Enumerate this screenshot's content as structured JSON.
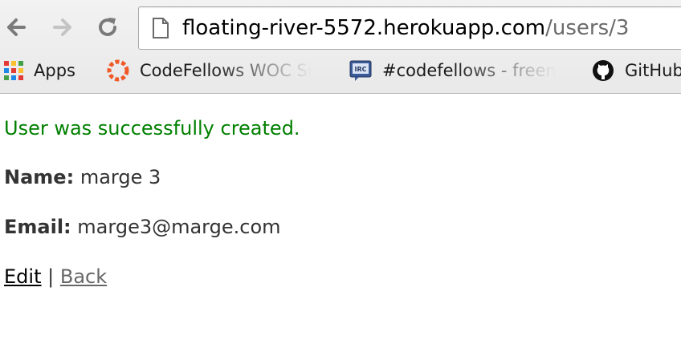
{
  "browser": {
    "url_host": "floating-river-5572.herokuapp.com",
    "url_path": "/users/3",
    "bookmarks": [
      {
        "label": "Apps",
        "icon": "apps-grid-icon"
      },
      {
        "label": "CodeFellows WOC Si",
        "icon": "codefellows-icon"
      },
      {
        "label": "#codefellows - freen",
        "icon": "irc-icon"
      },
      {
        "label": "GitHub",
        "icon": "github-icon"
      }
    ]
  },
  "page": {
    "notice": "User was successfully created.",
    "name_label": "Name:",
    "name_value": "marge 3",
    "email_label": "Email:",
    "email_value": "marge3@marge.com",
    "edit_link": "Edit",
    "separator": "|",
    "back_link": "Back"
  },
  "colors": {
    "notice": "#008000",
    "text": "#333333",
    "back_link": "#666666"
  }
}
